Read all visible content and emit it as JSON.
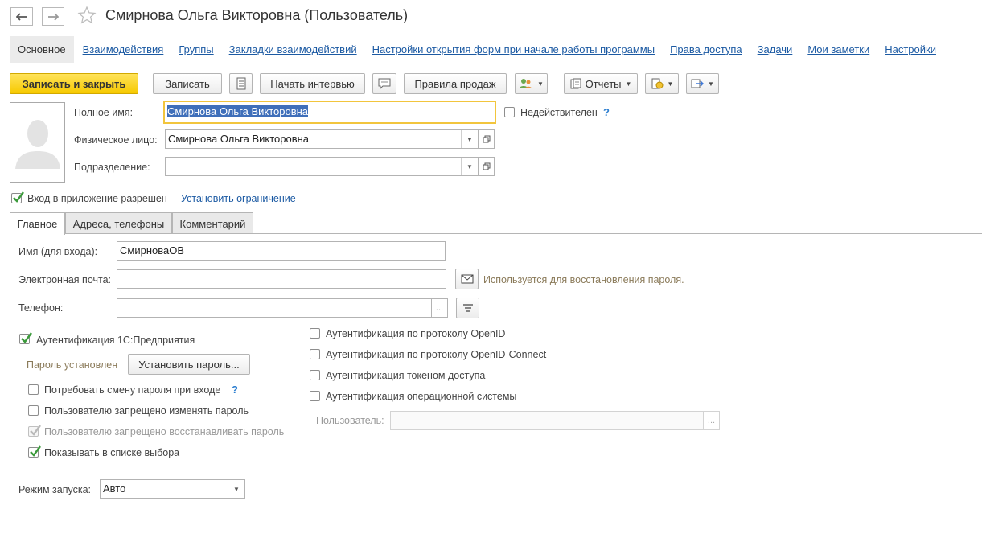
{
  "window": {
    "title": "Смирнова Ольга Викторовна (Пользователь)"
  },
  "nav_tabs": [
    {
      "label": "Основное"
    },
    {
      "label": "Взаимодействия"
    },
    {
      "label": "Группы"
    },
    {
      "label": "Закладки взаимодействий"
    },
    {
      "label": "Настройки открытия форм при начале работы программы"
    },
    {
      "label": "Права доступа"
    },
    {
      "label": "Задачи"
    },
    {
      "label": "Мои заметки"
    },
    {
      "label": "Настройки"
    }
  ],
  "toolbar": {
    "save_close": "Записать и закрыть",
    "save": "Записать",
    "interview": "Начать интервью",
    "sales_rules": "Правила продаж",
    "reports": "Отчеты"
  },
  "form": {
    "full_name_label": "Полное имя:",
    "full_name_value": "Смирнова Ольга Викторовна",
    "inactive_label": "Недействителен",
    "person_label": "Физическое лицо:",
    "person_value": "Смирнова Ольга Викторовна",
    "department_label": "Подразделение:",
    "department_value": "",
    "login_allowed_label": "Вход в приложение разрешен",
    "set_restriction_link": "Установить ограничение",
    "help_mark": "?"
  },
  "tabs": [
    {
      "label": "Главное"
    },
    {
      "label": "Адреса, телефоны"
    },
    {
      "label": "Комментарий"
    }
  ],
  "main": {
    "login_name_label": "Имя (для входа):",
    "login_name_value": "СмирноваОВ",
    "email_label": "Электронная почта:",
    "email_value": "",
    "email_note": "Используется для восстановления пароля.",
    "phone_label": "Телефон:",
    "phone_value": "",
    "ellipsis": "...",
    "auth_1c_label": "Аутентификация 1С:Предприятия",
    "password_set_label": "Пароль установлен",
    "set_password_button": "Установить пароль...",
    "require_change_label": "Потребовать смену пароля при входе",
    "forbid_change_label": "Пользователю запрещено изменять пароль",
    "forbid_restore_label": "Пользователю запрещено восстанавливать пароль",
    "show_in_list_label": "Показывать в списке выбора",
    "openid_label": "Аутентификация по протоколу OpenID",
    "openid_connect_label": "Аутентификация по протоколу OpenID-Connect",
    "token_label": "Аутентификация токеном доступа",
    "os_auth_label": "Аутентификация операционной системы",
    "os_user_label": "Пользователь:",
    "os_user_value": "",
    "launch_mode_label": "Режим запуска:",
    "launch_mode_value": "Авто"
  },
  "checkbox_states": {
    "inactive": false,
    "login_allowed": true,
    "auth_1c": true,
    "require_change": false,
    "forbid_change": false,
    "forbid_restore": true,
    "show_in_list": true,
    "openid": false,
    "openid_connect": false,
    "token": false,
    "os_auth": false
  },
  "colors": {
    "accent_yellow": "#f6c900",
    "link_blue": "#1c5aa3",
    "check_green": "#3a9a3a"
  }
}
